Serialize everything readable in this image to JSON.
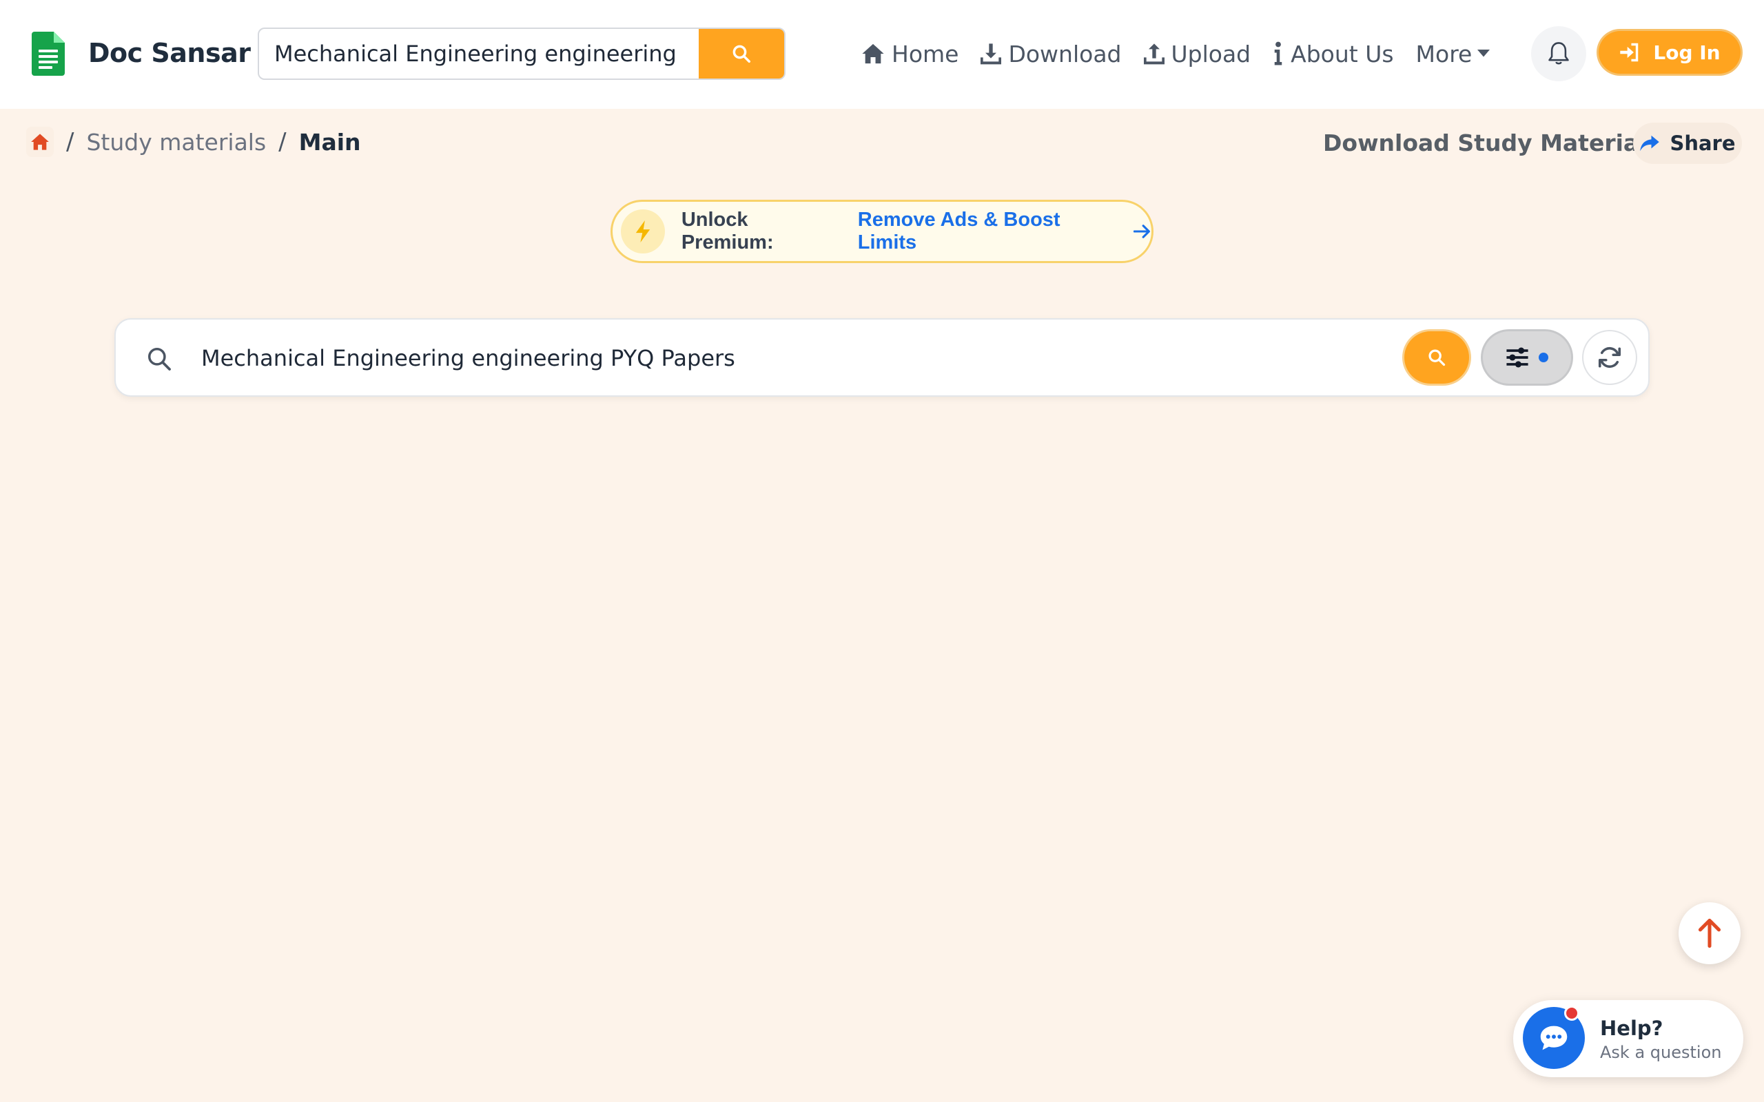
{
  "brand": {
    "name": "Doc Sansar",
    "icon": "green-document-icon",
    "color": "#16a34a"
  },
  "header_search": {
    "value": "Mechanical Engineering engineering PYQ Papers",
    "button_icon": "search-icon"
  },
  "nav": {
    "items": [
      {
        "label": "Home",
        "icon": "home-icon"
      },
      {
        "label": "Download",
        "icon": "download-icon"
      },
      {
        "label": "Upload",
        "icon": "upload-icon"
      },
      {
        "label": "About Us",
        "icon": "info-icon"
      },
      {
        "label": "More",
        "icon": "caret-down-icon"
      }
    ],
    "notification_icon": "bell-icon",
    "login_label": "Log In"
  },
  "breadcrumb": {
    "home_icon": "home-icon",
    "items": [
      {
        "label": "Study materials"
      },
      {
        "label": "Main"
      }
    ]
  },
  "page_actions": {
    "title": "Download Study Materials",
    "share_label": "Share"
  },
  "premium_banner": {
    "label": "Unlock Premium:",
    "link_text": "Remove Ads & Boost Limits"
  },
  "main_search": {
    "value": "Mechanical Engineering engineering PYQ Papers",
    "search_icon": "search-icon",
    "filter_icon": "sliders-icon",
    "refresh_icon": "refresh-icon"
  },
  "help": {
    "title": "Help?",
    "subtitle": "Ask a question"
  },
  "colors": {
    "accent": "#ffa41f",
    "link": "#1a6fe8",
    "background": "#fdf3ea",
    "home_red": "#e14b24"
  }
}
